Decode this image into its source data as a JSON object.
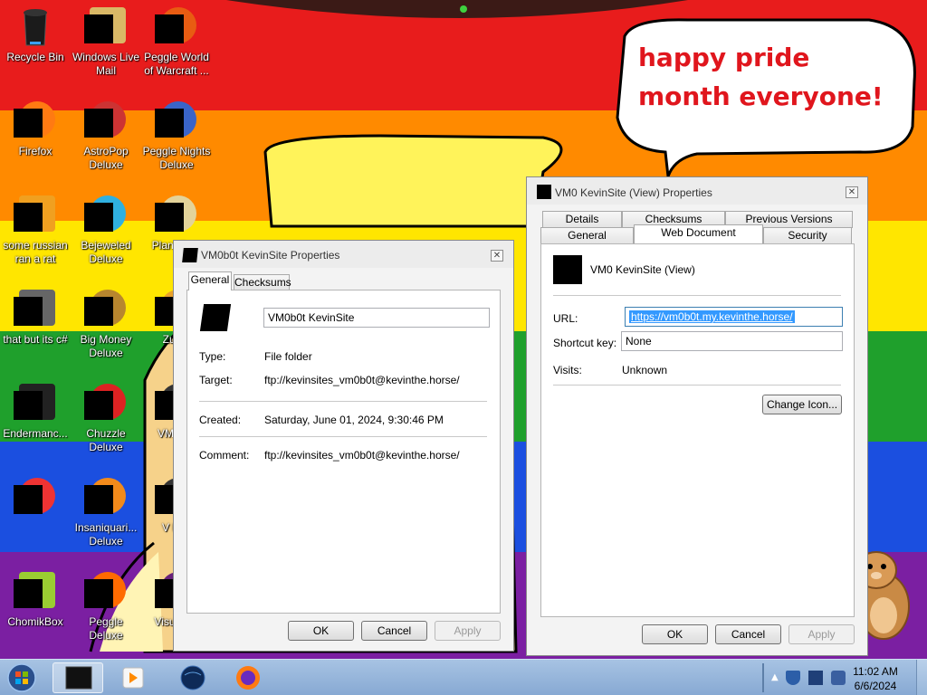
{
  "wallpaper": {
    "speech_bubble_text": "happy pride month everyone!",
    "stripe_colors": [
      "#e81c1c",
      "#ff8a00",
      "#ffe600",
      "#1fa02c",
      "#1b4fe0",
      "#7b1fa2"
    ]
  },
  "desktop_icons": [
    {
      "label": "Recycle Bin",
      "icon": "recycle-bin-icon"
    },
    {
      "label": "Windows Live Mail",
      "icon": "mail-icon"
    },
    {
      "label": "Peggle World of Warcraft ...",
      "icon": "peggle-icon"
    },
    {
      "label": "Firefox",
      "icon": "firefox-icon"
    },
    {
      "label": "AstroPop Deluxe",
      "icon": "astropop-icon"
    },
    {
      "label": "Peggle Nights Deluxe",
      "icon": "peggle-nights-icon"
    },
    {
      "label": "some russian ran a rat",
      "icon": "app-icon"
    },
    {
      "label": "Bejeweled Deluxe",
      "icon": "bejeweled-icon"
    },
    {
      "label": "Plant Zom",
      "icon": "plants-vs-zombies-icon"
    },
    {
      "label": "that but its c#",
      "icon": "app-icon"
    },
    {
      "label": "Big Money Deluxe",
      "icon": "big-money-icon"
    },
    {
      "label": "Zuma",
      "icon": "zuma-icon"
    },
    {
      "label": "Endermanc...",
      "icon": "app-icon"
    },
    {
      "label": "Chuzzle Deluxe",
      "icon": "chuzzle-icon"
    },
    {
      "label": "VM Kev",
      "icon": "app-icon"
    },
    {
      "label": "",
      "icon": "app-icon"
    },
    {
      "label": "Insaniquari... Deluxe",
      "icon": "insaniquarium-icon"
    },
    {
      "label": "V Kev",
      "icon": "app-icon"
    },
    {
      "label": "ChomikBox",
      "icon": "chomikbox-icon"
    },
    {
      "label": "Peggle Deluxe",
      "icon": "peggle-icon"
    },
    {
      "label": "Visual 20",
      "icon": "visual-studio-icon"
    }
  ],
  "folder_dialog": {
    "title": "VM0b0t KevinSite Properties",
    "tabs": [
      "General",
      "Checksums"
    ],
    "name_value": "VM0b0t KevinSite",
    "type_label": "Type:",
    "type_value": "File folder",
    "target_label": "Target:",
    "target_value": "ftp://kevinsites_vm0b0t@kevinthe.horse/",
    "created_label": "Created:",
    "created_value": "Saturday, June 01, 2024, 9:30:46 PM",
    "comment_label": "Comment:",
    "comment_value": "ftp://kevinsites_vm0b0t@kevinthe.horse/",
    "ok": "OK",
    "cancel": "Cancel",
    "apply": "Apply"
  },
  "web_dialog": {
    "title": "VM0 KevinSite (View) Properties",
    "tabs_top": [
      "Details",
      "Checksums",
      "Previous Versions"
    ],
    "tabs_bottom": [
      "General",
      "Web Document",
      "Security"
    ],
    "name_value": "VM0 KevinSite (View)",
    "url_label": "URL:",
    "url_value": "https://vm0b0t.my.kevinthe.horse/",
    "shortcut_label": "Shortcut key:",
    "shortcut_value": "None",
    "visits_label": "Visits:",
    "visits_value": "Unknown",
    "change_icon": "Change Icon...",
    "ok": "OK",
    "cancel": "Cancel",
    "apply": "Apply"
  },
  "taskbar": {
    "time": "11:02 AM",
    "date": "6/6/2024",
    "pinned": [
      "start-orb-icon",
      "vm-window-icon",
      "media-player-icon",
      "globe-icon",
      "firefox-icon"
    ]
  }
}
